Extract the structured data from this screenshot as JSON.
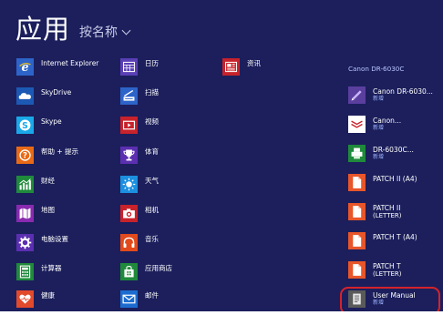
{
  "header": {
    "title": "应用",
    "sort_label": "按名称"
  },
  "columns": {
    "col1": [
      {
        "label": "Internet Explorer",
        "icon": "internet-explorer-icon",
        "color": "#2d64c9"
      },
      {
        "label": "SkyDrive",
        "icon": "skydrive-cloud-icon",
        "color": "#1c59b5"
      },
      {
        "label": "Skype",
        "icon": "skype-icon",
        "color": "#1aa8e8"
      },
      {
        "label": "帮助 + 提示",
        "icon": "help-icon",
        "color": "#e86a16"
      },
      {
        "label": "财经",
        "icon": "finance-chart-icon",
        "color": "#1f8a3b"
      },
      {
        "label": "地图",
        "icon": "maps-icon",
        "color": "#8a2ab0"
      },
      {
        "label": "电脑设置",
        "icon": "settings-gear-icon",
        "color": "#5b2fb0"
      },
      {
        "label": "计算器",
        "icon": "calculator-icon",
        "color": "#1f8a3b"
      },
      {
        "label": "健康",
        "icon": "health-heart-icon",
        "color": "#e24a2c"
      }
    ],
    "col2": [
      {
        "label": "日历",
        "icon": "calendar-icon",
        "color": "#5a3fb5"
      },
      {
        "label": "扫描",
        "icon": "scan-icon",
        "color": "#2d64c9"
      },
      {
        "label": "视频",
        "icon": "video-icon",
        "color": "#c8222b"
      },
      {
        "label": "体育",
        "icon": "sports-trophy-icon",
        "color": "#5b2fb0"
      },
      {
        "label": "天气",
        "icon": "weather-sun-icon",
        "color": "#1c8fe0"
      },
      {
        "label": "相机",
        "icon": "camera-icon",
        "color": "#c8222b"
      },
      {
        "label": "音乐",
        "icon": "music-headphones-icon",
        "color": "#e24a1c"
      },
      {
        "label": "应用商店",
        "icon": "store-bag-icon",
        "color": "#1f8a3b"
      },
      {
        "label": "邮件",
        "icon": "mail-icon",
        "color": "#1c6cd0"
      }
    ],
    "col3": [
      {
        "label": "资讯",
        "icon": "news-icon",
        "color": "#c8222b"
      }
    ],
    "col4": {
      "group_title": "Canon DR-6030C",
      "items": [
        {
          "label": "Canon DR-6030...",
          "sub": "新增",
          "icon": "canon-scanner-icon",
          "color": "#5a3f9f"
        },
        {
          "label": "Canon...",
          "sub": "新增",
          "icon": "canon-document-icon",
          "color": "#ffffff"
        },
        {
          "label": "DR-6030C...",
          "sub": "新增",
          "icon": "scanner-printer-icon",
          "color": "#1f8a3b"
        },
        {
          "label": "PATCH II (A4)",
          "sub": "",
          "icon": "pdf-document-icon",
          "color": "#e8562a"
        },
        {
          "label": "PATCH II",
          "sub": "(LETTER)",
          "icon": "pdf-document-icon",
          "color": "#e8562a"
        },
        {
          "label": "PATCH T (A4)",
          "sub": "",
          "icon": "pdf-document-icon",
          "color": "#e8562a"
        },
        {
          "label": "PATCH T",
          "sub": "(LETTER)",
          "icon": "pdf-document-icon",
          "color": "#e8562a"
        },
        {
          "label": "User Manual",
          "sub": "新增",
          "icon": "manual-document-icon",
          "color": "#5a5a5a"
        }
      ]
    }
  },
  "colors": {
    "background": "#1c1f5c",
    "highlight": "#d6232a"
  }
}
